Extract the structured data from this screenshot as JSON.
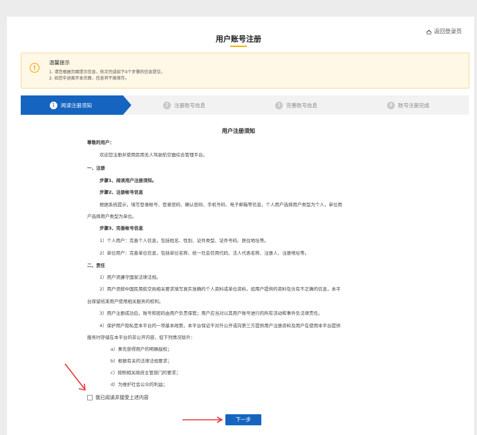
{
  "header": {
    "title": "用户账号注册",
    "back_label": "返回登录页"
  },
  "notice": {
    "icon": "exclamation-icon",
    "title": "温馨提示",
    "lines": [
      "1. 请您根据页面提示信息，依次完成如下4个步骤的信息提交。",
      "2. 如您中途离开本页面，信息将不被保存。"
    ]
  },
  "steps": [
    {
      "num": "1",
      "label": "阅读注册须知"
    },
    {
      "num": "2",
      "label": "注册账号信息"
    },
    {
      "num": "3",
      "label": "完善账号信息"
    },
    {
      "num": "4",
      "label": "账号注册完成"
    }
  ],
  "active_step": 1,
  "document": {
    "title": "用户注册须知",
    "greeting": "尊敬的用户：",
    "intro": "欢迎您注册并使用民用无人驾驶航空器综合管理平台。",
    "section1": {
      "heading": "一、注册",
      "step1": "步骤1、阅读用户注册须知。",
      "step2": "步骤2、注册帐号信息",
      "step2_desc_1": "根据系统提示，填写登录帐号、登录密码、确认密码、手机号码、电子邮箱等信息，个人用户选择用户类型为个人，单位用",
      "step2_desc_2": "户选择用户类型为单位。",
      "step3": "步骤3、完善帐号信息",
      "step3_item1": "1）个人用户：完善个人信息，包括姓名、性别、证件类型、证件号码、居住地址等。",
      "step3_item2": "2）单位用户：完善单位信息，包括单位名称、统一社会信用代码、法人代表名称、注册人、注册地址等。"
    },
    "section2": {
      "heading": "二、责任",
      "item1": "1）用户须遵守国家法律法规。",
      "item2_1": "2）用户须按中国民用航空局相关要求填写真实准确的个人资料或单位资料，如用户提供的资料包含有不正确的信息，本平",
      "item2_2": "台保留结束用户使用相关服务的权利。",
      "item3": "3）用户注册成功后，账号和密码由用户负责保管；用户应当对以其用户账号进行的所有活动和事件负法律责任。",
      "item4_1": "4）保护用户隐私是本平台的一项基本政策，本平台保证不对外公开或向第三方提供用户注册资料及用户在使用本平台提供",
      "item4_2": "服务时存储在本平台的非公开内容，但下列情况除外：",
      "sub_a": "a）事先获得用户的明确授权；",
      "sub_b": "b）根据有关的法律法规要求；",
      "sub_c": "c）按照相关政府主管部门的要求；",
      "sub_d": "d）为维护社会公众的利益；"
    }
  },
  "agreement_label": "我已阅读并接受上述内容",
  "next_button": "下一步",
  "colors": {
    "primary": "#1565c0",
    "accent": "#f0b400",
    "notice_bg": "#fff8e6",
    "annotation_arrow": "#e53935"
  }
}
